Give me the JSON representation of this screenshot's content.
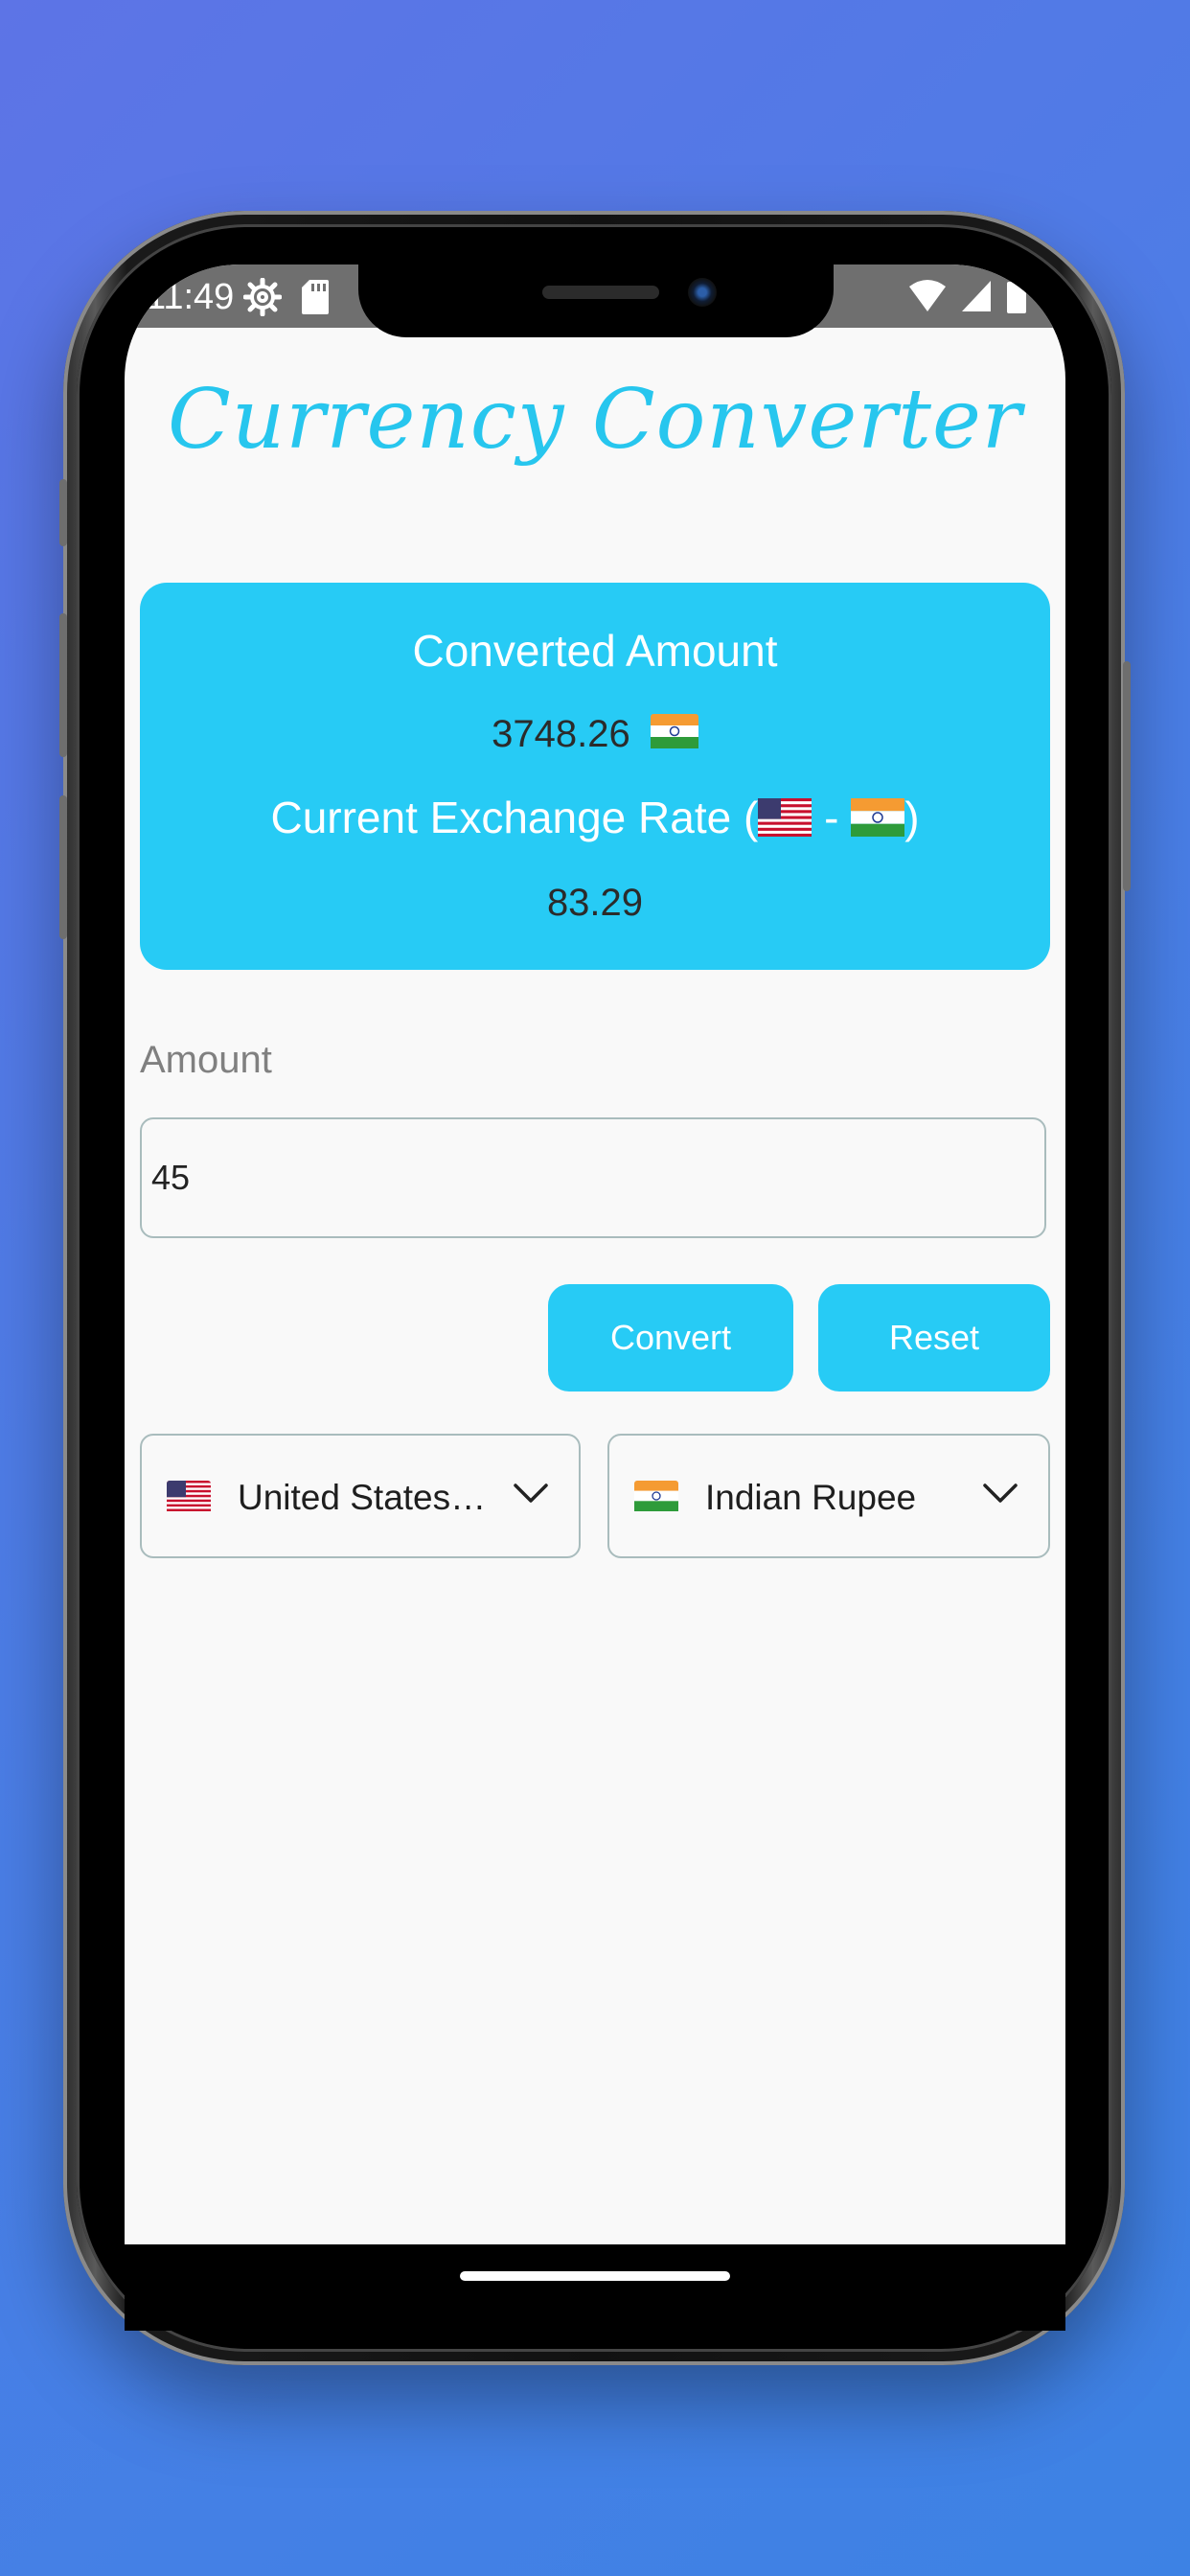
{
  "status_bar": {
    "time": "11:49",
    "left_icons": [
      "settings-gear-icon",
      "sd-card-icon"
    ],
    "right_icons": [
      "wifi-icon",
      "cell-signal-icon",
      "battery-icon"
    ]
  },
  "app": {
    "title": "Currency Converter"
  },
  "result_card": {
    "converted_label": "Converted Amount",
    "converted_value": "3748.26",
    "converted_flag": "india-flag-icon",
    "rate_label_prefix": "Current Exchange Rate (",
    "rate_label_separator": " - ",
    "rate_label_suffix": ")",
    "rate_from_flag": "us-flag-icon",
    "rate_to_flag": "india-flag-icon",
    "rate_value": "83.29"
  },
  "form": {
    "amount_label": "Amount",
    "amount_value": "45",
    "convert_label": "Convert",
    "reset_label": "Reset"
  },
  "dropdowns": {
    "from": {
      "label": "United States…",
      "flag": "us-flag-icon"
    },
    "to": {
      "label": "Indian Rupee",
      "flag": "india-flag-icon"
    }
  },
  "colors": {
    "accent": "#27cbf5",
    "title": "#27c6ee",
    "background_gradient_start": "#5d74e6",
    "background_gradient_end": "#3d82e4"
  }
}
